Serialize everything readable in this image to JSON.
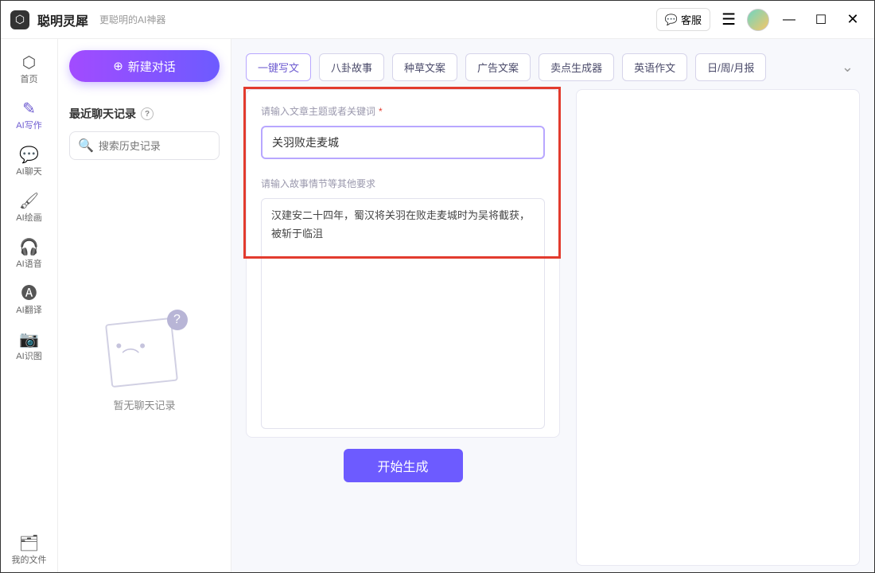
{
  "titlebar": {
    "app_name": "聪明灵犀",
    "app_sub": "更聪明的AI神器",
    "kefu_label": "客服"
  },
  "sidebar": {
    "items": [
      {
        "icon": "⬡",
        "label": "首页"
      },
      {
        "icon": "✎",
        "label": "AI写作"
      },
      {
        "icon": "💬",
        "label": "AI聊天"
      },
      {
        "icon": "🖌",
        "label": "AI绘画"
      },
      {
        "icon": "🎧",
        "label": "AI语音"
      },
      {
        "icon": "🅐",
        "label": "AI翻译"
      },
      {
        "icon": "📷",
        "label": "AI识图"
      }
    ],
    "footer": {
      "icon": "🗂",
      "label": "我的文件"
    }
  },
  "chatlist": {
    "new_label": "新建对话",
    "recent_title": "最近聊天记录",
    "search_placeholder": "搜索历史记录",
    "empty_text": "暂无聊天记录"
  },
  "tabs": {
    "items": [
      "一键写文",
      "八卦故事",
      "种草文案",
      "广告文案",
      "卖点生成器",
      "英语作文",
      "日/周/月报"
    ],
    "active_index": 0
  },
  "form": {
    "label_topic": "请输入文章主题或者关键词",
    "topic_value": "关羽败走麦城",
    "label_detail": "请输入故事情节等其他要求",
    "detail_value": "汉建安二十四年，蜀汉将关羽在败走麦城时为吴将截获，被斩于临沮",
    "generate_label": "开始生成"
  }
}
